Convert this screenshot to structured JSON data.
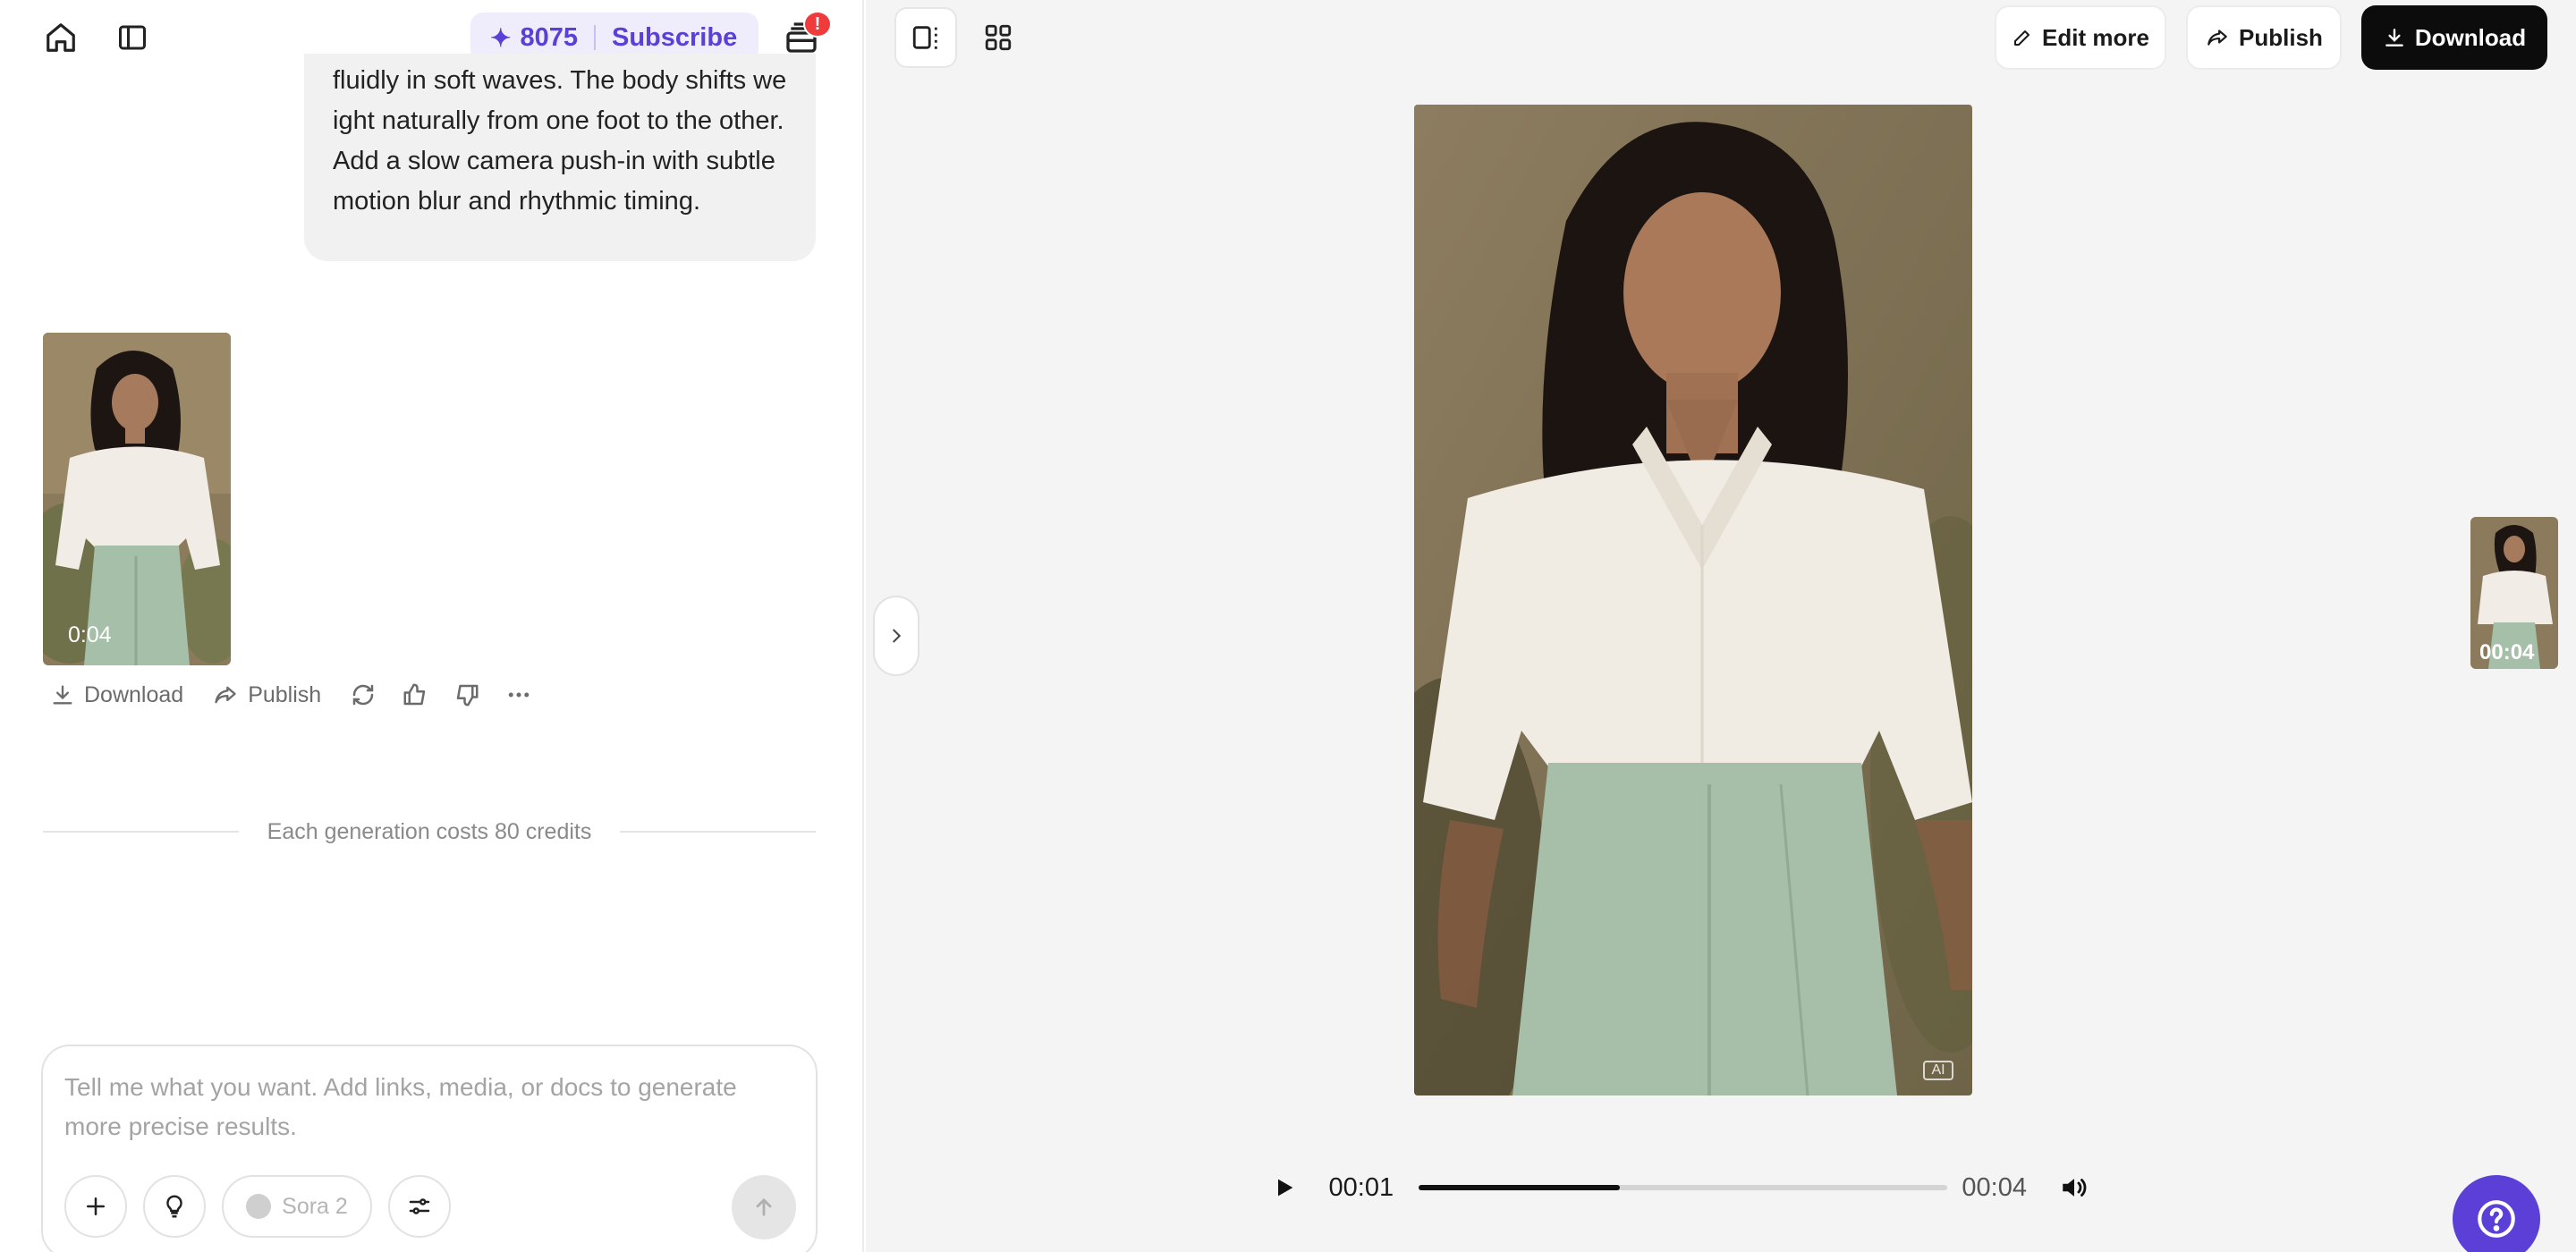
{
  "header": {
    "credits": "8075",
    "subscribe_label": "Subscribe",
    "notification_count": "!"
  },
  "chat": {
    "prompt_text": "fluidly in soft waves. The body shifts weight naturally from one foot to the other. Add a slow camera push-in with subtle motion blur and rhythmic timing.",
    "result": {
      "duration": "0:04"
    },
    "actions": {
      "download_label": "Download",
      "publish_label": "Publish"
    },
    "cost_note": "Each generation costs 80 credits"
  },
  "composer": {
    "placeholder": "Tell me what you want. Add links, media, or docs to generate more precise results.",
    "model_label": "Sora 2"
  },
  "preview": {
    "edit_label": "Edit more",
    "publish_label": "Publish",
    "download_label": "Download",
    "ai_badge": "AI",
    "side_thumb_duration": "00:04",
    "player": {
      "current_time": "00:01",
      "total_time": "00:04",
      "progress": 0.38
    }
  },
  "colors": {
    "accent": "#5b40d8",
    "notification": "#ef3b3b",
    "download_button": "#0c0c0c"
  }
}
